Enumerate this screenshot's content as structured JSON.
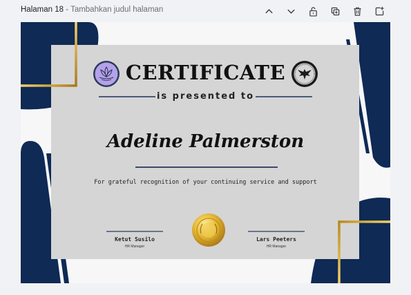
{
  "page": {
    "label": "Halaman 18",
    "separator": "-",
    "title_placeholder": "Tambahkan judul halaman"
  },
  "toolbar": {
    "icons": [
      "chevron-up-icon",
      "chevron-down-icon",
      "unlock-icon",
      "duplicate-icon",
      "trash-icon",
      "add-page-icon"
    ]
  },
  "certificate": {
    "title": "CERTIFICATE",
    "subtitle": "is presented to",
    "recipient": "Adeline Palmerston",
    "recognition": "For grateful recognition of your continuing service and support",
    "signers": [
      {
        "name": "Ketut Susilo",
        "role": "HR Manager"
      },
      {
        "name": "Lars Peeters",
        "role": "HR Manager"
      }
    ],
    "colors": {
      "navy": "#0e2a55",
      "gold": "#c9a227",
      "panel": "#d5d5d5",
      "lotus_purple": "#b3a2ea"
    }
  }
}
